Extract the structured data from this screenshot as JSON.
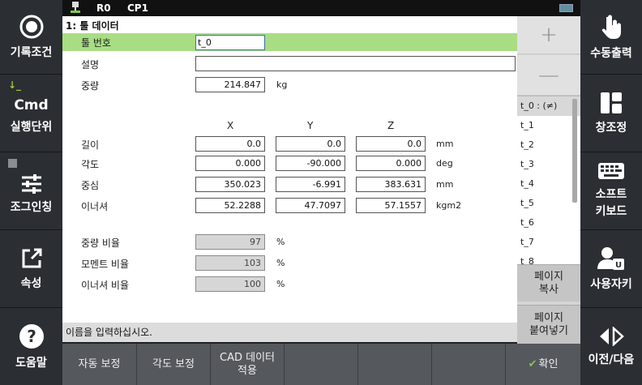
{
  "status": {
    "r0": "R0",
    "cp": "CP1"
  },
  "left_sidebar": [
    {
      "icon": "record-condition-icon",
      "label": "기록조건"
    },
    {
      "icon": "cmd-icon",
      "title": "Cmd",
      "label": "실행단위"
    },
    {
      "icon": "jog-sliders-icon",
      "label": "조그인칭"
    },
    {
      "icon": "edit-external-icon",
      "label": "속성"
    },
    {
      "icon": "help-icon",
      "label": "도움말"
    }
  ],
  "right_sidebar": [
    {
      "icon": "hand-pointer-icon",
      "label": "수동출력"
    },
    {
      "icon": "window-layout-icon",
      "label": "창조정"
    },
    {
      "icon": "keyboard-icon",
      "label1": "소프트",
      "label2": "키보드"
    },
    {
      "icon": "user-key-icon",
      "label": "사용자키"
    },
    {
      "icon": "prev-next-icon",
      "label": "이전/다음"
    }
  ],
  "form": {
    "title": "1: 툴 데이터",
    "tool_number_label": "툴 번호",
    "tool_number_value": "t_0",
    "description_label": "설명",
    "description_value": "",
    "weight_label": "중량",
    "weight_value": "214.847",
    "weight_unit": "kg",
    "headers": [
      "X",
      "Y",
      "Z"
    ],
    "rows": [
      {
        "label": "길이",
        "values": [
          "0.0",
          "0.0",
          "0.0"
        ],
        "unit": "mm"
      },
      {
        "label": "각도",
        "values": [
          "0.000",
          "-90.000",
          "0.000"
        ],
        "unit": "deg"
      },
      {
        "label": "중심",
        "values": [
          "350.023",
          "-6.991",
          "383.631"
        ],
        "unit": "mm"
      },
      {
        "label": "이너셔",
        "values": [
          "52.2288",
          "47.7097",
          "57.1557"
        ],
        "unit": "kgm2"
      }
    ],
    "ratios": [
      {
        "label": "중량 비율",
        "value": "97",
        "unit": "%"
      },
      {
        "label": "모멘트 비율",
        "value": "103",
        "unit": "%"
      },
      {
        "label": "이너셔 비율",
        "value": "100",
        "unit": "%"
      }
    ]
  },
  "message": "이름을 입력하십시오.",
  "right_panel": {
    "plus": "+",
    "minus": "—",
    "tools": [
      "t_0 : (≠)",
      "t_1",
      "t_2",
      "t_3",
      "t_4",
      "t_5",
      "t_6",
      "t_7",
      "t_8"
    ],
    "page_copy": [
      "페이지",
      "복사"
    ],
    "page_paste": [
      "페이지",
      "붙여넣기"
    ]
  },
  "bottom": {
    "auto": "자동 보정",
    "angle": "각도 보정",
    "cad1": "CAD 데이터",
    "cad2": "적용",
    "ok": "확인"
  }
}
